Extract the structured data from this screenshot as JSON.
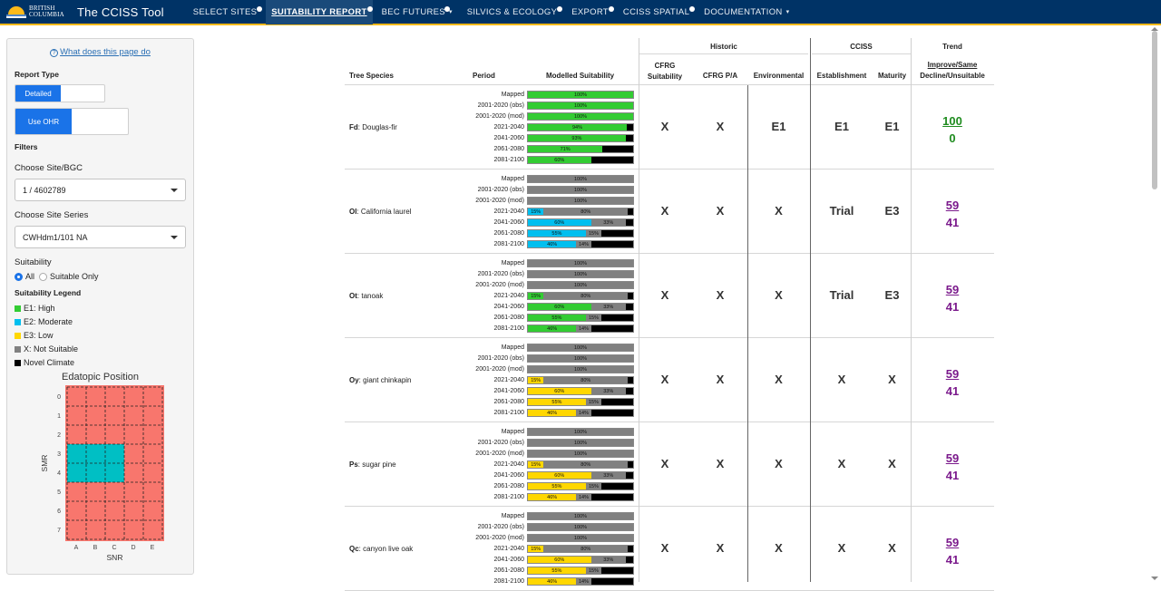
{
  "nav": {
    "logo_text_1": "BRITISH",
    "logo_text_2": "COLUMBIA",
    "brand": "The CCISS Tool",
    "items": [
      {
        "label": "SELECT SITES",
        "active": false,
        "dot": true,
        "dropdown": false
      },
      {
        "label": "SUITABILITY REPORT",
        "active": true,
        "dot": true,
        "dropdown": false
      },
      {
        "label": "BEC FUTURES",
        "active": false,
        "dot": true,
        "dropdown": true
      },
      {
        "label": "SILVICS & ECOLOGY",
        "active": false,
        "dot": true,
        "dropdown": false
      },
      {
        "label": "EXPORT",
        "active": false,
        "dot": true,
        "dropdown": false
      },
      {
        "label": "CCISS SPATIAL",
        "active": false,
        "dot": true,
        "dropdown": false
      },
      {
        "label": "DOCUMENTATION",
        "active": false,
        "dot": false,
        "dropdown": true
      }
    ]
  },
  "sidebar": {
    "help_link": "What does this page do",
    "report_type_label": "Report Type",
    "detailed_label": "Detailed",
    "use_ohr_label": "Use OHR",
    "filters_label": "Filters",
    "site_bgc_label": "Choose Site/BGC",
    "site_bgc_value": "1 / 4602789",
    "site_series_label": "Choose Site Series",
    "site_series_value": "CWHdm1/101 NA",
    "suitability_label": "Suitability",
    "radio_all": "All",
    "radio_suitable": "Suitable Only",
    "legend_title": "Suitability Legend",
    "legend": [
      {
        "label": "E1: High",
        "color": "#33cc33"
      },
      {
        "label": "E2: Moderate",
        "color": "#00bfef"
      },
      {
        "label": "E3: Low",
        "color": "#ffd700"
      },
      {
        "label": "X: Not Suitable",
        "color": "#808080"
      },
      {
        "label": "Novel Climate",
        "color": "#000000"
      }
    ],
    "edatopic": {
      "title": "Edatopic Position",
      "ylabel": "SMR",
      "xlabel": "SNR",
      "y_ticks": [
        "0",
        "1",
        "2",
        "3",
        "4",
        "5",
        "6",
        "7"
      ],
      "x_ticks": [
        "A",
        "B",
        "C",
        "D",
        "E"
      ],
      "base_color": "#f8766d",
      "highlight_color": "#00bfc4",
      "highlight_cells": [
        [
          3,
          0
        ],
        [
          3,
          1
        ],
        [
          3,
          2
        ],
        [
          4,
          0
        ],
        [
          4,
          1
        ],
        [
          4,
          2
        ]
      ]
    }
  },
  "table": {
    "headers": {
      "historic": "Historic",
      "cciss": "CCISS",
      "trend": "Trend",
      "tree_species": "Tree Species",
      "period": "Period",
      "modelled_suitability": "Modelled Suitability",
      "cfrg_suitability": "CFRG\nSuitability",
      "cfrg_pa": "CFRG P/A",
      "environmental": "Environmental",
      "establishment": "Establishment",
      "maturity": "Maturity",
      "improve_same": "Improve/Same",
      "decline_unsuitable": "Decline/Unsuitable"
    },
    "periods": [
      "Mapped",
      "2001-2020 (obs)",
      "2001-2020 (mod)",
      "2021-2040",
      "2041-2060",
      "2061-2080",
      "2081-2100"
    ],
    "rows": [
      {
        "code": "Fd",
        "name": "Douglas-fir",
        "bars": [
          [
            {
              "v": 100,
              "c": "#33cc33",
              "t": "100%"
            }
          ],
          [
            {
              "v": 100,
              "c": "#33cc33",
              "t": "100%"
            }
          ],
          [
            {
              "v": 100,
              "c": "#33cc33",
              "t": "100%"
            }
          ],
          [
            {
              "v": 94,
              "c": "#33cc33",
              "t": "94%"
            },
            {
              "v": 6,
              "c": "#000000",
              "t": ""
            }
          ],
          [
            {
              "v": 93,
              "c": "#33cc33",
              "t": "93%"
            },
            {
              "v": 7,
              "c": "#000000",
              "t": ""
            }
          ],
          [
            {
              "v": 71,
              "c": "#33cc33",
              "t": "71%"
            },
            {
              "v": 29,
              "c": "#000000",
              "t": ""
            }
          ],
          [
            {
              "v": 60,
              "c": "#33cc33",
              "t": "60%"
            },
            {
              "v": 40,
              "c": "#000000",
              "t": ""
            }
          ]
        ],
        "cfrg": "X",
        "cfrg_pa": "X",
        "environmental": "E1",
        "establishment": "E1",
        "maturity": "E1",
        "improve": "100",
        "decline": "0",
        "trend_color": "#1f8c1f",
        "improve_underline": true
      },
      {
        "code": "Ol",
        "name": "California laurel",
        "bars": [
          [
            {
              "v": 100,
              "c": "#808080",
              "t": "100%"
            }
          ],
          [
            {
              "v": 100,
              "c": "#808080",
              "t": "100%"
            }
          ],
          [
            {
              "v": 100,
              "c": "#808080",
              "t": "100%"
            }
          ],
          [
            {
              "v": 15,
              "c": "#00bfef",
              "t": "15%"
            },
            {
              "v": 80,
              "c": "#808080",
              "t": "80%"
            },
            {
              "v": 5,
              "c": "#000000",
              "t": ""
            }
          ],
          [
            {
              "v": 60,
              "c": "#00bfef",
              "t": "60%"
            },
            {
              "v": 33,
              "c": "#808080",
              "t": "33%"
            },
            {
              "v": 7,
              "c": "#000000",
              "t": ""
            }
          ],
          [
            {
              "v": 55,
              "c": "#00bfef",
              "t": "55%"
            },
            {
              "v": 15,
              "c": "#808080",
              "t": "15%"
            },
            {
              "v": 30,
              "c": "#000000",
              "t": ""
            }
          ],
          [
            {
              "v": 46,
              "c": "#00bfef",
              "t": "46%"
            },
            {
              "v": 14,
              "c": "#808080",
              "t": "14%"
            },
            {
              "v": 40,
              "c": "#000000",
              "t": ""
            }
          ]
        ],
        "cfrg": "X",
        "cfrg_pa": "X",
        "environmental": "X",
        "establishment": "Trial",
        "maturity": "E3",
        "improve": "59",
        "decline": "41",
        "trend_color": "#7b1a8c",
        "improve_underline": true
      },
      {
        "code": "Ot",
        "name": "tanoak",
        "bars": [
          [
            {
              "v": 100,
              "c": "#808080",
              "t": "100%"
            }
          ],
          [
            {
              "v": 100,
              "c": "#808080",
              "t": "100%"
            }
          ],
          [
            {
              "v": 100,
              "c": "#808080",
              "t": "100%"
            }
          ],
          [
            {
              "v": 15,
              "c": "#33cc33",
              "t": "15%"
            },
            {
              "v": 80,
              "c": "#808080",
              "t": "80%"
            },
            {
              "v": 5,
              "c": "#000000",
              "t": ""
            }
          ],
          [
            {
              "v": 60,
              "c": "#33cc33",
              "t": "60%"
            },
            {
              "v": 33,
              "c": "#808080",
              "t": "33%"
            },
            {
              "v": 7,
              "c": "#000000",
              "t": ""
            }
          ],
          [
            {
              "v": 55,
              "c": "#33cc33",
              "t": "55%"
            },
            {
              "v": 15,
              "c": "#808080",
              "t": "15%"
            },
            {
              "v": 30,
              "c": "#000000",
              "t": ""
            }
          ],
          [
            {
              "v": 46,
              "c": "#33cc33",
              "t": "46%"
            },
            {
              "v": 14,
              "c": "#808080",
              "t": "14%"
            },
            {
              "v": 40,
              "c": "#000000",
              "t": ""
            }
          ]
        ],
        "cfrg": "X",
        "cfrg_pa": "X",
        "environmental": "X",
        "establishment": "Trial",
        "maturity": "E3",
        "improve": "59",
        "decline": "41",
        "trend_color": "#7b1a8c",
        "improve_underline": true
      },
      {
        "code": "Oy",
        "name": "giant chinkapin",
        "bars": [
          [
            {
              "v": 100,
              "c": "#808080",
              "t": "100%"
            }
          ],
          [
            {
              "v": 100,
              "c": "#808080",
              "t": "100%"
            }
          ],
          [
            {
              "v": 100,
              "c": "#808080",
              "t": "100%"
            }
          ],
          [
            {
              "v": 15,
              "c": "#ffd700",
              "t": "15%"
            },
            {
              "v": 80,
              "c": "#808080",
              "t": "80%"
            },
            {
              "v": 5,
              "c": "#000000",
              "t": ""
            }
          ],
          [
            {
              "v": 60,
              "c": "#ffd700",
              "t": "60%"
            },
            {
              "v": 33,
              "c": "#808080",
              "t": "33%"
            },
            {
              "v": 7,
              "c": "#000000",
              "t": ""
            }
          ],
          [
            {
              "v": 55,
              "c": "#ffd700",
              "t": "55%"
            },
            {
              "v": 15,
              "c": "#808080",
              "t": "15%"
            },
            {
              "v": 30,
              "c": "#000000",
              "t": ""
            }
          ],
          [
            {
              "v": 46,
              "c": "#ffd700",
              "t": "46%"
            },
            {
              "v": 14,
              "c": "#808080",
              "t": "14%"
            },
            {
              "v": 40,
              "c": "#000000",
              "t": ""
            }
          ]
        ],
        "cfrg": "X",
        "cfrg_pa": "X",
        "environmental": "X",
        "establishment": "X",
        "maturity": "X",
        "improve": "59",
        "decline": "41",
        "trend_color": "#7b1a8c",
        "improve_underline": true
      },
      {
        "code": "Ps",
        "name": "sugar pine",
        "bars": [
          [
            {
              "v": 100,
              "c": "#808080",
              "t": "100%"
            }
          ],
          [
            {
              "v": 100,
              "c": "#808080",
              "t": "100%"
            }
          ],
          [
            {
              "v": 100,
              "c": "#808080",
              "t": "100%"
            }
          ],
          [
            {
              "v": 15,
              "c": "#ffd700",
              "t": "15%"
            },
            {
              "v": 80,
              "c": "#808080",
              "t": "80%"
            },
            {
              "v": 5,
              "c": "#000000",
              "t": ""
            }
          ],
          [
            {
              "v": 60,
              "c": "#ffd700",
              "t": "60%"
            },
            {
              "v": 33,
              "c": "#808080",
              "t": "33%"
            },
            {
              "v": 7,
              "c": "#000000",
              "t": ""
            }
          ],
          [
            {
              "v": 55,
              "c": "#ffd700",
              "t": "55%"
            },
            {
              "v": 15,
              "c": "#808080",
              "t": "15%"
            },
            {
              "v": 30,
              "c": "#000000",
              "t": ""
            }
          ],
          [
            {
              "v": 46,
              "c": "#ffd700",
              "t": "46%"
            },
            {
              "v": 14,
              "c": "#808080",
              "t": "14%"
            },
            {
              "v": 40,
              "c": "#000000",
              "t": ""
            }
          ]
        ],
        "cfrg": "X",
        "cfrg_pa": "X",
        "environmental": "X",
        "establishment": "X",
        "maturity": "X",
        "improve": "59",
        "decline": "41",
        "trend_color": "#7b1a8c",
        "improve_underline": true
      },
      {
        "code": "Qc",
        "name": "canyon live oak",
        "bars": [
          [
            {
              "v": 100,
              "c": "#808080",
              "t": "100%"
            }
          ],
          [
            {
              "v": 100,
              "c": "#808080",
              "t": "100%"
            }
          ],
          [
            {
              "v": 100,
              "c": "#808080",
              "t": "100%"
            }
          ],
          [
            {
              "v": 15,
              "c": "#ffd700",
              "t": "15%"
            },
            {
              "v": 80,
              "c": "#808080",
              "t": "80%"
            },
            {
              "v": 5,
              "c": "#000000",
              "t": ""
            }
          ],
          [
            {
              "v": 60,
              "c": "#ffd700",
              "t": "60%"
            },
            {
              "v": 33,
              "c": "#808080",
              "t": "33%"
            },
            {
              "v": 7,
              "c": "#000000",
              "t": ""
            }
          ],
          [
            {
              "v": 55,
              "c": "#ffd700",
              "t": "55%"
            },
            {
              "v": 15,
              "c": "#808080",
              "t": "15%"
            },
            {
              "v": 30,
              "c": "#000000",
              "t": ""
            }
          ],
          [
            {
              "v": 46,
              "c": "#ffd700",
              "t": "46%"
            },
            {
              "v": 14,
              "c": "#808080",
              "t": "14%"
            },
            {
              "v": 40,
              "c": "#000000",
              "t": ""
            }
          ]
        ],
        "cfrg": "X",
        "cfrg_pa": "X",
        "environmental": "X",
        "establishment": "X",
        "maturity": "X",
        "improve": "59",
        "decline": "41",
        "trend_color": "#7b1a8c",
        "improve_underline": true
      }
    ]
  }
}
